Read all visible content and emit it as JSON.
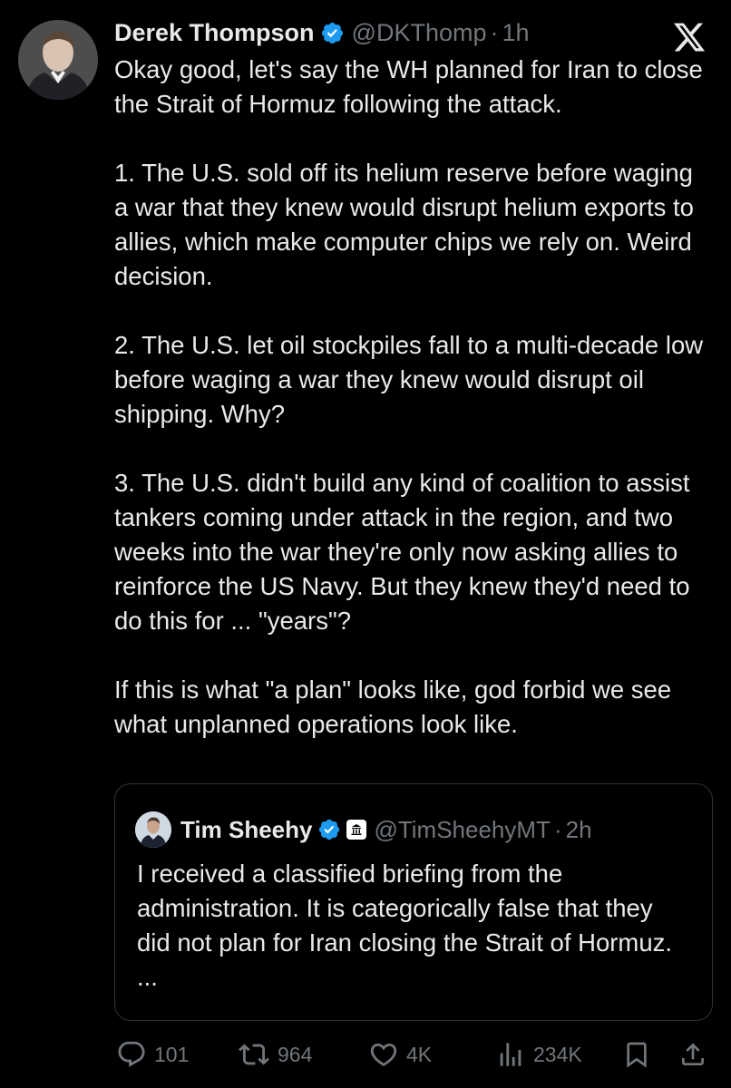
{
  "tweet": {
    "author": {
      "name": "Derek Thompson",
      "handle": "@DKThomp",
      "separator": "·",
      "time": "1h",
      "avatar_icon": "profile-photo",
      "verified_icon": "verified-badge-icon"
    },
    "paragraphs": [
      "Okay good, let's say the WH planned for Iran to close the Strait of Hormuz following the attack.",
      "1. The U.S. sold off its helium reserve before waging a war that they knew would disrupt helium exports to allies, which make computer chips we rely on. Weird decision.",
      "2. The U.S. let oil stockpiles fall to a multi-decade low before waging a war they knew would disrupt oil shipping. Why?",
      "3. The U.S. didn't build any kind of coalition to assist tankers coming under attack in the region, and two weeks into the war they're only now asking allies to reinforce the US Navy. But they knew they'd need to do this for ... \"years\"?",
      "If this is what \"a plan\" looks like, god forbid we see what unplanned operations look like."
    ],
    "quote": {
      "name": "Tim Sheehy",
      "handle": "@TimSheehyMT",
      "separator": "·",
      "time": "2h",
      "text": "I received a classified briefing from the administration. It is categorically false that they did not plan for Iran closing the Strait of Hormuz. ..."
    },
    "actions": {
      "replies": "101",
      "reposts": "964",
      "likes": "4K",
      "views": "234K"
    }
  },
  "colors": {
    "background": "#000000",
    "text": "#e7e9ea",
    "secondary_text": "#71767b",
    "verified": "#1d9bf0",
    "border": "#2f3336"
  }
}
